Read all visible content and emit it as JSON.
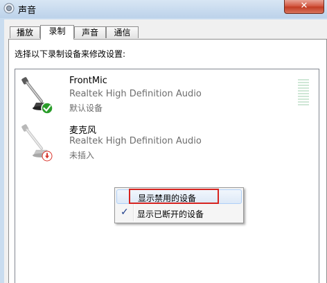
{
  "window": {
    "title": "声音",
    "close_label": "✕"
  },
  "tabs": [
    {
      "label": "播放"
    },
    {
      "label": "录制"
    },
    {
      "label": "声音"
    },
    {
      "label": "通信"
    }
  ],
  "recording": {
    "instruction": "选择以下录制设备来修改设置:",
    "devices": [
      {
        "name": "FrontMic",
        "description": "Realtek High Definition Audio",
        "status": "默认设备",
        "icon": "microphone-default-icon"
      },
      {
        "name": "麦克风",
        "description": "Realtek High Definition Audio",
        "status": "未插入",
        "icon": "microphone-unplugged-icon"
      }
    ]
  },
  "context_menu": {
    "items": [
      {
        "label": "显示禁用的设备",
        "checked": false
      },
      {
        "label": "显示已断开的设备",
        "checked": true,
        "check_glyph": "✓"
      }
    ]
  },
  "colors": {
    "accent_highlight": "#d7231e",
    "default_badge": "#2a9d2a",
    "unplugged_badge": "#d9342b"
  }
}
